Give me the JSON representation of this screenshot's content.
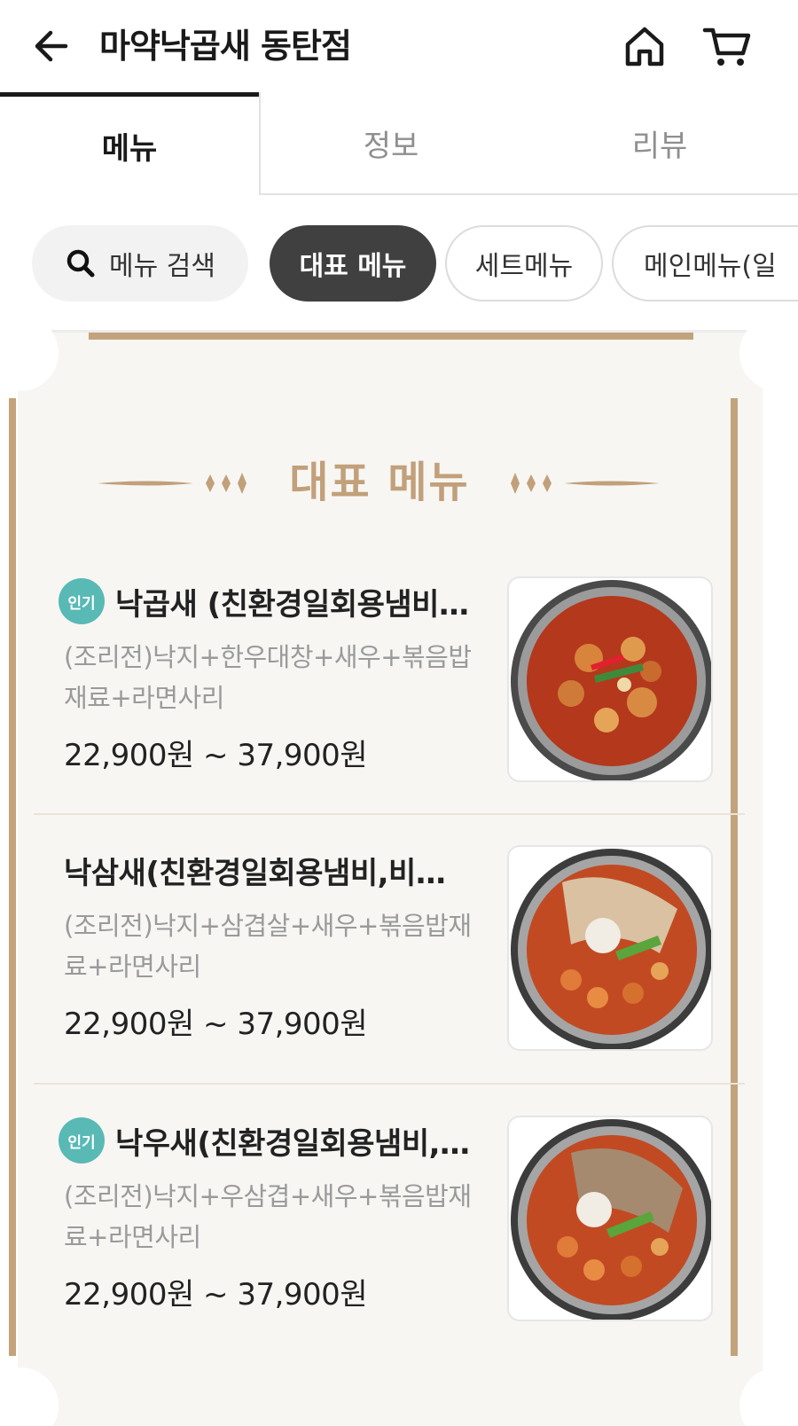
{
  "header": {
    "title": "마약낙곱새 동탄점",
    "back_icon": "arrow-left-icon",
    "home_icon": "home-icon",
    "cart_icon": "cart-icon"
  },
  "tabs": [
    {
      "label": "메뉴",
      "active": true
    },
    {
      "label": "정보",
      "active": false
    },
    {
      "label": "리뷰",
      "active": false
    }
  ],
  "chips": {
    "search_label": "메뉴 검색",
    "items": [
      {
        "label": "대표 메뉴",
        "active": true
      },
      {
        "label": "세트메뉴",
        "active": false
      },
      {
        "label": "메인메뉴(일",
        "active": false
      }
    ]
  },
  "section": {
    "title": "대표 메뉴"
  },
  "menu_items": [
    {
      "badge": "인기",
      "name": "낙곱새 (친환경일회용냄비…",
      "desc": "(조리전)낙지+한우대창+새우+볶음밥재료+라면사리",
      "price": "22,900원 ~ 37,900원"
    },
    {
      "badge": "",
      "name": "낙삼새(친환경일회용냄비,비…",
      "desc": "(조리전)낙지+삼겹살+새우+볶음밥재료+라면사리",
      "price": "22,900원 ~ 37,900원"
    },
    {
      "badge": "인기",
      "name": "낙우새(친환경일회용냄비,…",
      "desc": "(조리전)낙지+우삼겹+새우+볶음밥재료+라면사리",
      "price": "22,900원 ~ 37,900원"
    }
  ],
  "colors": {
    "accent_gold": "#c1a07a",
    "badge_teal": "#58b9b5",
    "chip_active": "#404040"
  }
}
